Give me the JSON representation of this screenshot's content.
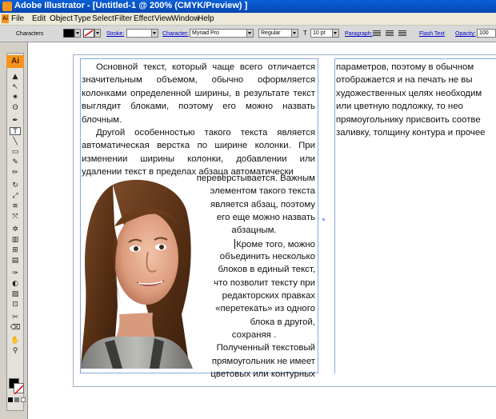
{
  "window": {
    "title": "Adobe Illustrator - [Untitled-1 @ 200% (CMYK/Preview) ]"
  },
  "menu": [
    "File",
    "Edit",
    "Object",
    "Type",
    "Select",
    "Filter",
    "Effect",
    "View",
    "Window",
    "Help"
  ],
  "control": {
    "panel_label": "Characters",
    "stroke_label": "Stroke:",
    "character_label": "Character:",
    "font_family": "Myriad Pro",
    "font_style": "Regular",
    "font_size": "10 pt",
    "paragraph_label": "Paragraph:",
    "flash_text_label": "Flash Text",
    "opacity_label": "Opacity:",
    "opacity_value": "100",
    "fill_color": "#000000",
    "stroke_color": "#ffffff"
  },
  "tools": {
    "app_badge": "Ai",
    "icons": [
      "selection-icon",
      "direct-selection-icon",
      "magic-wand-icon",
      "lasso-icon",
      "pen-icon",
      "type-icon",
      "line-icon",
      "rectangle-icon",
      "paintbrush-icon",
      "pencil-icon",
      "rotate-icon",
      "scale-icon",
      "warp-icon",
      "free-transform-icon",
      "symbol-sprayer-icon",
      "graph-icon",
      "mesh-icon",
      "gradient-icon",
      "eyedropper-icon",
      "blend-icon",
      "live-paint-icon",
      "slice-icon",
      "scissors-icon",
      "eraser-icon",
      "hand-icon",
      "zoom-icon"
    ],
    "glyphs": [
      "▲",
      "↖",
      "✷",
      "ʘ",
      "✒",
      "T",
      "╲",
      "▭",
      "✎",
      "✏",
      "↻",
      "⤢",
      "≋",
      "⤧",
      "✲",
      "▥",
      "⊞",
      "▤",
      "✑",
      "◐",
      "▨",
      "⊡",
      "✂",
      "⌫",
      "✋",
      "⚲"
    ],
    "selected_index": 5
  },
  "document": {
    "col1_para1": "Основной текст, который чаще всего отличается значительным объемом, обычно оформляется колонками определенной ширины, в результате текст выглядит блоками, поэтому его можно назвать блочным.",
    "col1_para2": "Другой особенностью такого текста является автоматическая верстка по ширине колонки. При изменении ширины колонки, добавлении или удалении текст в пределах абзаца автоматически",
    "wrap_lines": [
      "переверстывается.   Важным",
      "элементом такого текста",
      "является абзац, поэтому",
      "его еще можно назвать",
      "абзацным.",
      "Кроме того, можно",
      "объединить несколько",
      "блоков  в единый текст,",
      "что позволит тексту при",
      "редакторских правках",
      "«перетекать» из одного",
      "блока      в      другой,",
      "сохраняя .",
      "Полученный текстовый",
      "прямоугольник   не   имеет",
      "цветовых   или   контурных"
    ],
    "col2_lines": [
      "параметров,  поэтому в обычном",
      "отображается и на печать не вы",
      "художественных целях необходим",
      "или цветную подложку, то нео",
      "прямоугольнику присвоить соотве",
      "заливку, толщину контура и прочее"
    ]
  }
}
